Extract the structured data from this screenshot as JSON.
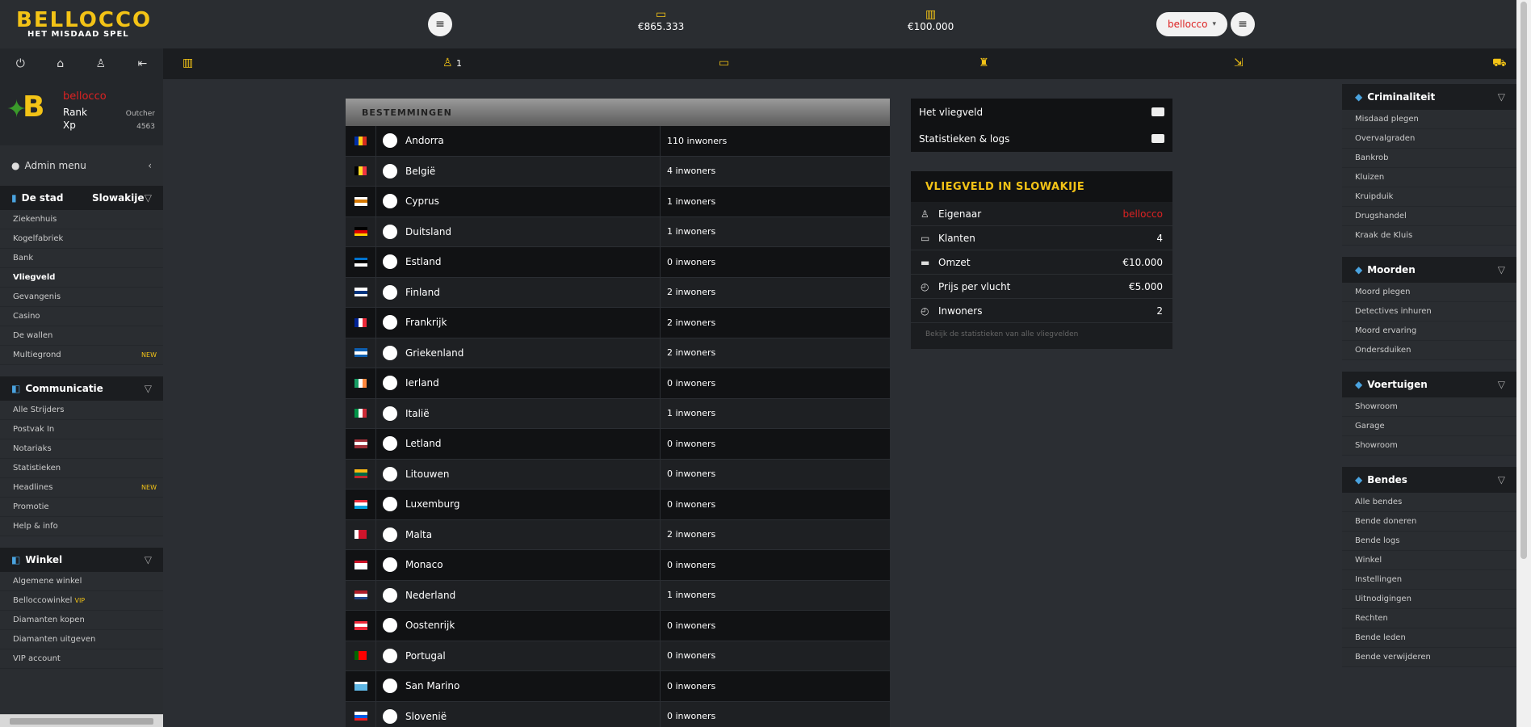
{
  "header": {
    "logo_title": "BELLOCCO",
    "logo_subtitle": "HET MISDAAD SPEL",
    "money_cash": "€865.333",
    "money_bank": "€100.000",
    "user_button": "bellocco",
    "caret": "▾"
  },
  "profile": {
    "username": "bellocco",
    "rank_label": "Rank",
    "rank_value": "Outcher",
    "xp_label": "Xp",
    "xp_value": "4563",
    "logo_letter": "B"
  },
  "navbar": {
    "crew_count": "1"
  },
  "sidebar_left": {
    "admin_menu": "Admin menu",
    "city_section": {
      "title": "De stad",
      "current_city": "Slowakije"
    },
    "city_items": [
      {
        "label": "Ziekenhuis"
      },
      {
        "label": "Kogelfabriek"
      },
      {
        "label": "Bank"
      },
      {
        "label": "Vliegveld"
      },
      {
        "label": "Gevangenis"
      },
      {
        "label": "Casino"
      },
      {
        "label": "De wallen"
      },
      {
        "label": "Multiegrond",
        "badge": "NEW"
      }
    ],
    "comm_section": {
      "title": "Communicatie"
    },
    "comm_items": [
      {
        "label": "Alle Strijders"
      },
      {
        "label": "Postvak In"
      },
      {
        "label": "Notariaks"
      },
      {
        "label": "Statistieken"
      },
      {
        "label": "Headlines",
        "badge": "NEW"
      },
      {
        "label": "Promotie"
      },
      {
        "label": "Help & info"
      }
    ],
    "shop_section": {
      "title": "Winkel"
    },
    "shop_items": [
      {
        "label": "Algemene winkel"
      },
      {
        "label": "Belloccowinkel",
        "badge": "VIP"
      },
      {
        "label": "Diamanten kopen"
      },
      {
        "label": "Diamanten uitgeven"
      },
      {
        "label": "VIP account"
      }
    ]
  },
  "destinations": {
    "header": "BESTEMMINGEN",
    "rows": [
      {
        "country": "Andorra",
        "residents": "110 inwoners",
        "flag": [
          "#002fa7",
          "#fcd116",
          "#d52b1e"
        ],
        "dir": "v"
      },
      {
        "country": "België",
        "residents": "4 inwoners",
        "flag": [
          "#000000",
          "#fdda24",
          "#ef3340"
        ],
        "dir": "v"
      },
      {
        "country": "Cyprus",
        "residents": "1 inwoners",
        "flag": [
          "#ffffff",
          "#d57800",
          "#ffffff"
        ],
        "dir": "h"
      },
      {
        "country": "Duitsland",
        "residents": "1 inwoners",
        "flag": [
          "#000000",
          "#dd0000",
          "#ffce00"
        ],
        "dir": "h"
      },
      {
        "country": "Estland",
        "residents": "0 inwoners",
        "flag": [
          "#0072ce",
          "#000000",
          "#ffffff"
        ],
        "dir": "h"
      },
      {
        "country": "Finland",
        "residents": "2 inwoners",
        "flag": [
          "#ffffff",
          "#003580",
          "#ffffff"
        ],
        "dir": "h"
      },
      {
        "country": "Frankrijk",
        "residents": "2 inwoners",
        "flag": [
          "#002395",
          "#ffffff",
          "#ed2939"
        ],
        "dir": "v"
      },
      {
        "country": "Griekenland",
        "residents": "2 inwoners",
        "flag": [
          "#0d5eaf",
          "#ffffff",
          "#0d5eaf"
        ],
        "dir": "h"
      },
      {
        "country": "Ierland",
        "residents": "0 inwoners",
        "flag": [
          "#169b62",
          "#ffffff",
          "#ff883e"
        ],
        "dir": "v"
      },
      {
        "country": "Italië",
        "residents": "1 inwoners",
        "flag": [
          "#009246",
          "#ffffff",
          "#ce2b37"
        ],
        "dir": "v"
      },
      {
        "country": "Letland",
        "residents": "0 inwoners",
        "flag": [
          "#9e3039",
          "#ffffff",
          "#9e3039"
        ],
        "dir": "h"
      },
      {
        "country": "Litouwen",
        "residents": "0 inwoners",
        "flag": [
          "#fdb913",
          "#006a44",
          "#c1272d"
        ],
        "dir": "h"
      },
      {
        "country": "Luxemburg",
        "residents": "0 inwoners",
        "flag": [
          "#ed2939",
          "#ffffff",
          "#00a1de"
        ],
        "dir": "h"
      },
      {
        "country": "Malta",
        "residents": "2 inwoners",
        "flag": [
          "#ffffff",
          "#cf142b",
          "#cf142b"
        ],
        "dir": "v"
      },
      {
        "country": "Monaco",
        "residents": "0 inwoners",
        "flag": [
          "#ce1126",
          "#ffffff",
          "#ffffff"
        ],
        "dir": "h"
      },
      {
        "country": "Nederland",
        "residents": "1 inwoners",
        "flag": [
          "#ae1c28",
          "#ffffff",
          "#21468b"
        ],
        "dir": "h"
      },
      {
        "country": "Oostenrijk",
        "residents": "0 inwoners",
        "flag": [
          "#ed2939",
          "#ffffff",
          "#ed2939"
        ],
        "dir": "h"
      },
      {
        "country": "Portugal",
        "residents": "0 inwoners",
        "flag": [
          "#006600",
          "#ff0000",
          "#ff0000"
        ],
        "dir": "v"
      },
      {
        "country": "San Marino",
        "residents": "0 inwoners",
        "flag": [
          "#ffffff",
          "#5eb6e4",
          "#5eb6e4"
        ],
        "dir": "h"
      },
      {
        "country": "Slovenië",
        "residents": "0 inwoners",
        "flag": [
          "#ffffff",
          "#005ce5",
          "#ed1c24"
        ],
        "dir": "h"
      }
    ]
  },
  "links": {
    "airport": "Het vliegveld",
    "stats": "Statistieken & logs"
  },
  "airport": {
    "title": "VLIEGVELD IN SLOWAKIJE",
    "owner_label": "Eigenaar",
    "owner_value": "bellocco",
    "clients_label": "Klanten",
    "clients_value": "4",
    "revenue_label": "Omzet",
    "revenue_value": "€10.000",
    "price_label": "Prijs per vlucht",
    "price_value": "€5.000",
    "residents_label": "Inwoners",
    "residents_value": "2",
    "footer": "Bekijk de statistieken van alle vliegvelden"
  },
  "sidebar_right": {
    "sections": [
      {
        "title": "Criminaliteit",
        "items": [
          "Misdaad plegen",
          "Overvalgraden",
          "Bankrob",
          "Kluizen",
          "Kruipduik",
          "Drugshandel",
          "Kraak de Kluis"
        ]
      },
      {
        "title": "Moorden",
        "items": [
          "Moord plegen",
          "Detectives inhuren",
          "Moord ervaring",
          "Ondersduiken"
        ]
      },
      {
        "title": "Voertuigen",
        "items": [
          "Showroom",
          "Garage",
          "Showroom"
        ]
      },
      {
        "title": "Bendes",
        "items": [
          "Alle bendes",
          "Bende doneren",
          "Bende logs",
          "Winkel",
          "Instellingen",
          "Uitnodigingen",
          "Rechten",
          "Bende leden",
          "Bende verwijderen"
        ]
      }
    ]
  },
  "icons": {
    "accent": "#f3c316",
    "info": "#4aa3df",
    "danger": "#dd2222"
  }
}
